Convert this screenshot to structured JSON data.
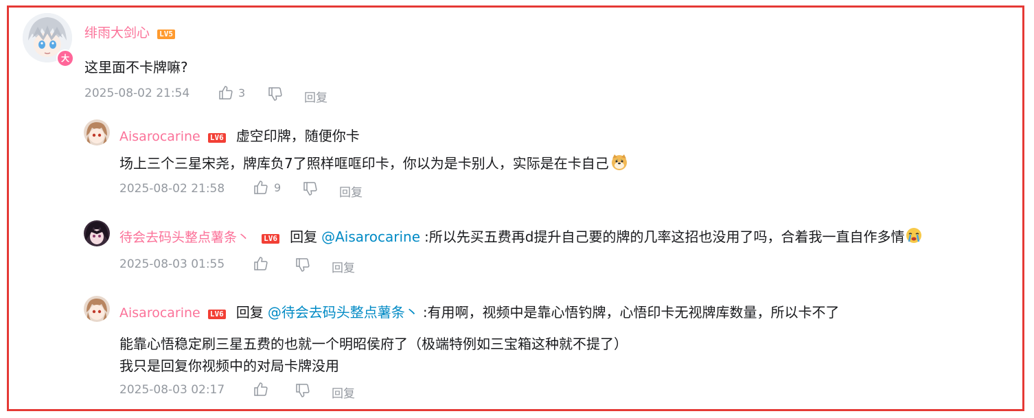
{
  "comment": {
    "user": "绯雨大剑心",
    "level": "LV5",
    "badge": "大",
    "text": "这里面不卡牌嘛?",
    "time": "2025-08-02 21:54",
    "likes": "3",
    "reply_label": "回复"
  },
  "replies": [
    {
      "user": "Aisarocarine",
      "level": "LV6",
      "lines": [
        "虚空印牌，随便你卡",
        "场上三个三星宋尧，牌库负7了照样哐哐印卡，你以为是卡别人，实际是在卡自己"
      ],
      "time": "2025-08-02 21:58",
      "likes": "9",
      "reply_label": "回复"
    },
    {
      "user": "待会去码头整点薯条丶",
      "level": "LV6",
      "prefix": "回复",
      "mention": "@Aisarocarine",
      "text": ":所以先买五费再d提升自己要的牌的几率这招也没用了吗，合着我一直自作多情",
      "time": "2025-08-03 01:55",
      "reply_label": "回复"
    },
    {
      "user": "Aisarocarine",
      "level": "LV6",
      "prefix": "回复",
      "mention": "@待会去码头整点薯条丶",
      "text": ":有用啊，视频中是靠心悟钓牌，心悟印卡无视牌库数量，所以卡不了",
      "lines": [
        "能靠心悟稳定刷三星五费的也就一个明昭侯府了（极端特例如三宝箱这种就不提了）",
        "我只是回复你视频中的对局卡牌没用"
      ],
      "time": "2025-08-03 02:17",
      "reply_label": "回复"
    }
  ],
  "icons": {
    "like": "thumbs-up-icon",
    "dislike": "thumbs-down-icon",
    "emoji_doge": "doge-emoji",
    "emoji_cry": "crying-emoji"
  },
  "colors": {
    "username": "#fb7299",
    "mention": "#008ac5",
    "meta": "#9499a0",
    "frame": "#e53935"
  }
}
